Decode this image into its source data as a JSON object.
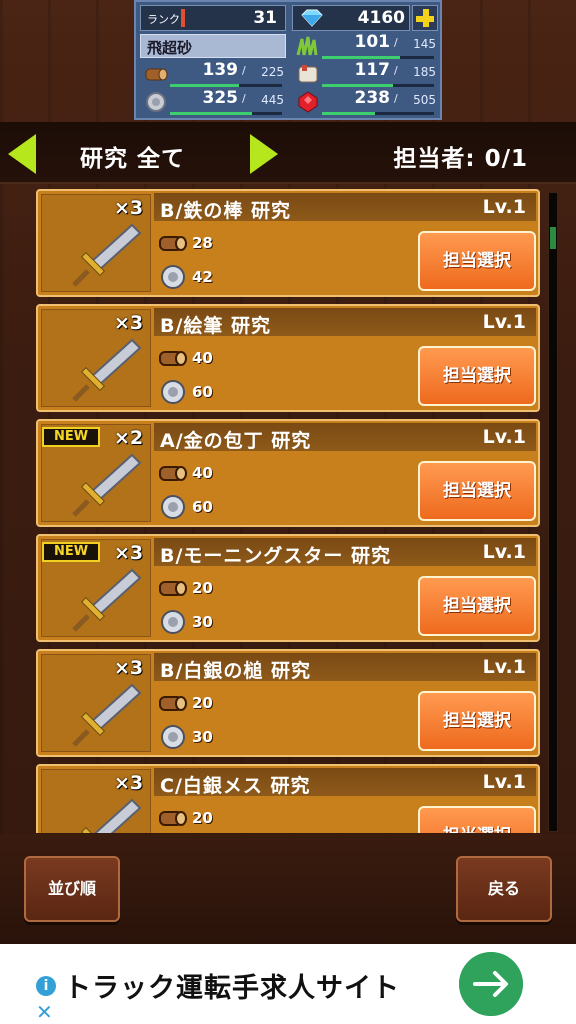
{
  "status": {
    "rank_label": "ランク",
    "rank": "31",
    "gems": "4160",
    "name": "飛超砂",
    "resources": [
      {
        "icon": "grass-icon",
        "current": "101",
        "max": "145",
        "fill": 0.7
      },
      {
        "icon": "wood-log-icon",
        "current": "139",
        "max": "225",
        "fill": 0.62
      },
      {
        "icon": "cloth-icon",
        "current": "117",
        "max": "185",
        "fill": 0.63
      },
      {
        "icon": "coin-icon",
        "current": "325",
        "max": "445",
        "fill": 0.73
      },
      {
        "icon": "ruby-icon",
        "current": "238",
        "max": "505",
        "fill": 0.47
      }
    ],
    "separator": "/"
  },
  "header": {
    "title": "研究 全て",
    "staff": "担当者: 0/1"
  },
  "cards": [
    {
      "title": "B/鉄の棒 研究",
      "lv": "Lv.1",
      "mult": "×3",
      "new": false,
      "wood": "28",
      "coin": "42",
      "button": "担当選択"
    },
    {
      "title": "B/絵筆 研究",
      "lv": "Lv.1",
      "mult": "×3",
      "new": false,
      "wood": "40",
      "coin": "60",
      "button": "担当選択"
    },
    {
      "title": "A/金の包丁 研究",
      "lv": "Lv.1",
      "mult": "×2",
      "new": true,
      "wood": "40",
      "coin": "60",
      "button": "担当選択"
    },
    {
      "title": "B/モーニングスター 研究",
      "lv": "Lv.1",
      "mult": "×3",
      "new": true,
      "wood": "20",
      "coin": "30",
      "button": "担当選択"
    },
    {
      "title": "B/白銀の槌 研究",
      "lv": "Lv.1",
      "mult": "×3",
      "new": false,
      "wood": "20",
      "coin": "30",
      "button": "担当選択"
    },
    {
      "title": "C/白銀メス 研究",
      "lv": "Lv.1",
      "mult": "×3",
      "new": false,
      "wood": "20",
      "coin": "",
      "button": "担当選択"
    }
  ],
  "new_label": "NEW",
  "footer": {
    "sort": "並び順",
    "back": "戻る"
  },
  "ad": {
    "text": "トラック運転手求人サイト",
    "info": "i",
    "close": "✕"
  },
  "colors": {
    "accent_arrow": "#b6e61c",
    "card": "#c8801d",
    "button": "#ee6a1e",
    "bar_fill": "#3dcf6d"
  }
}
